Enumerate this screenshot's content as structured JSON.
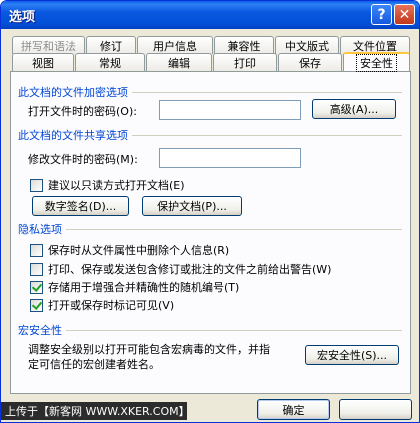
{
  "window": {
    "title": "选项",
    "help_glyph": "?",
    "close_glyph": "✕"
  },
  "tabs": {
    "row1": [
      "拼写和语法",
      "修订",
      "用户信息",
      "兼容性",
      "中文版式",
      "文件位置"
    ],
    "row2": [
      "视图",
      "常规",
      "编辑",
      "打印",
      "保存",
      "安全性"
    ],
    "active": "安全性"
  },
  "encryption": {
    "heading": "此文档的文件加密选项",
    "open_password_label": "打开文件时的密码(O):",
    "open_password_value": "",
    "advanced_button": "高级(A)..."
  },
  "sharing": {
    "heading": "此文档的文件共享选项",
    "modify_password_label": "修改文件时的密码(M):",
    "modify_password_value": "",
    "readonly_label": "建议以只读方式打开文档(E)",
    "readonly_checked": false,
    "digital_signature_button": "数字签名(D)...",
    "protect_document_button": "保护文档(P)..."
  },
  "privacy": {
    "heading": "隐私选项",
    "options": [
      {
        "label": "保存时从文件属性中删除个人信息(R)",
        "checked": false
      },
      {
        "label": "打印、保存或发送包含修订或批注的文件之前给出警告(W)",
        "checked": false
      },
      {
        "label": "存储用于增强合并精确性的随机编号(T)",
        "checked": true
      },
      {
        "label": "打开或保存时标记可见(V)",
        "checked": true
      }
    ]
  },
  "macro": {
    "heading": "宏安全性",
    "description_line1": "调整安全级别以打开可能包含宏病毒的文件，并指",
    "description_line2": "定可信任的宏创建者姓名。",
    "button": "宏安全性(S)..."
  },
  "footer": {
    "watermark": "上传于【新客网 WWW.XKER.COM】",
    "ok_button": "确定"
  }
}
